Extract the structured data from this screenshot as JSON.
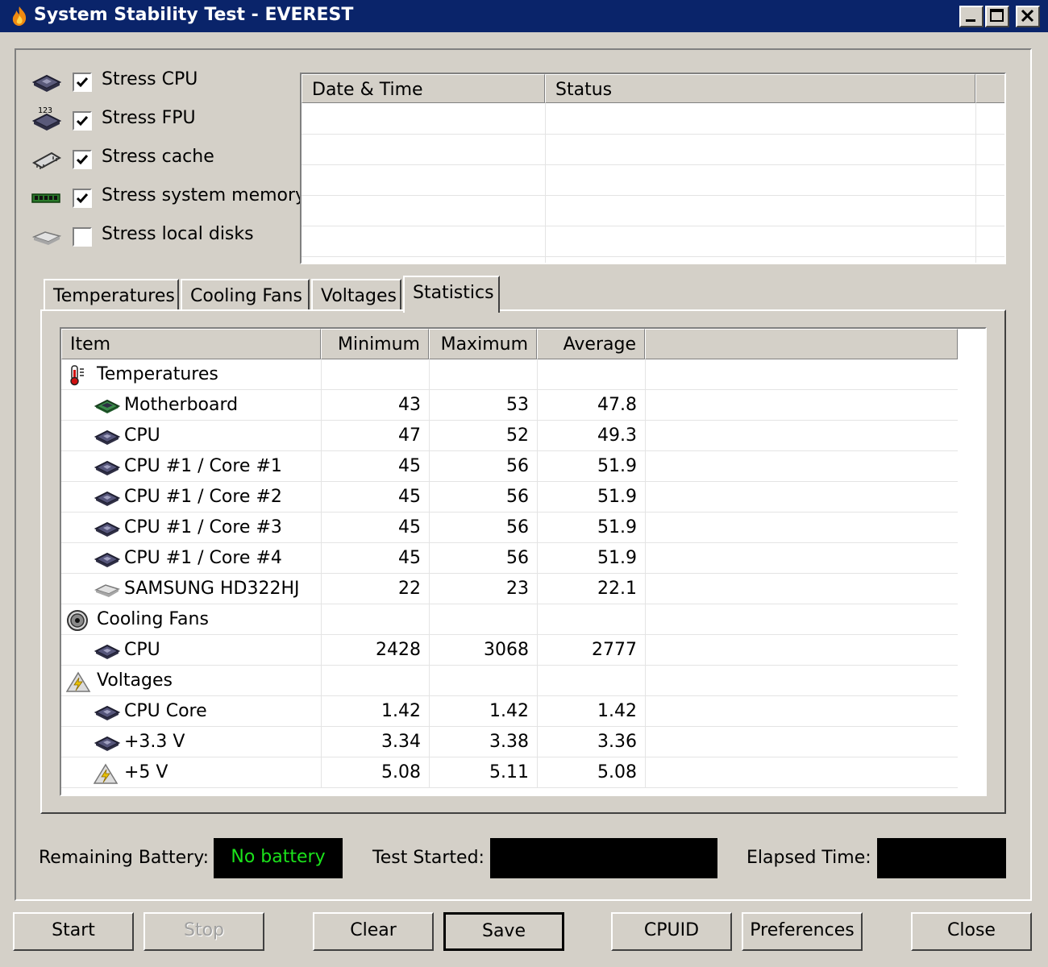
{
  "window": {
    "title": "System Stability Test - EVEREST"
  },
  "stress_options": [
    {
      "label": "Stress CPU",
      "checked": true,
      "icon": "cpu-chip-icon"
    },
    {
      "label": "Stress FPU",
      "checked": true,
      "icon": "fpu-chip-icon"
    },
    {
      "label": "Stress cache",
      "checked": true,
      "icon": "cache-chip-icon"
    },
    {
      "label": "Stress system memory",
      "checked": true,
      "icon": "memory-module-icon"
    },
    {
      "label": "Stress local disks",
      "checked": false,
      "icon": "hard-disk-icon"
    }
  ],
  "log": {
    "columns": [
      "Date & Time",
      "Status"
    ],
    "rows": []
  },
  "tabs": [
    {
      "label": "Temperatures",
      "active": false
    },
    {
      "label": "Cooling Fans",
      "active": false
    },
    {
      "label": "Voltages",
      "active": false
    },
    {
      "label": "Statistics",
      "active": true
    }
  ],
  "statistics": {
    "columns": [
      "Item",
      "Minimum",
      "Maximum",
      "Average"
    ],
    "rows": [
      {
        "type": "group",
        "name": "Temperatures",
        "icon": "thermometer-icon"
      },
      {
        "type": "item",
        "name": "Motherboard",
        "min": "43",
        "max": "53",
        "avg": "47.8",
        "icon": "motherboard-icon"
      },
      {
        "type": "item",
        "name": "CPU",
        "min": "47",
        "max": "52",
        "avg": "49.3",
        "icon": "cpu-chip-icon"
      },
      {
        "type": "item",
        "name": "CPU #1 / Core #1",
        "min": "45",
        "max": "56",
        "avg": "51.9",
        "icon": "cpu-chip-icon"
      },
      {
        "type": "item",
        "name": "CPU #1 / Core #2",
        "min": "45",
        "max": "56",
        "avg": "51.9",
        "icon": "cpu-chip-icon"
      },
      {
        "type": "item",
        "name": "CPU #1 / Core #3",
        "min": "45",
        "max": "56",
        "avg": "51.9",
        "icon": "cpu-chip-icon"
      },
      {
        "type": "item",
        "name": "CPU #1 / Core #4",
        "min": "45",
        "max": "56",
        "avg": "51.9",
        "icon": "cpu-chip-icon"
      },
      {
        "type": "item",
        "name": "SAMSUNG HD322HJ",
        "min": "22",
        "max": "23",
        "avg": "22.1",
        "icon": "hard-disk-icon"
      },
      {
        "type": "group",
        "name": "Cooling Fans",
        "icon": "fan-icon"
      },
      {
        "type": "item",
        "name": "CPU",
        "min": "2428",
        "max": "3068",
        "avg": "2777",
        "icon": "cpu-chip-icon"
      },
      {
        "type": "group",
        "name": "Voltages",
        "icon": "voltage-icon"
      },
      {
        "type": "item",
        "name": "CPU Core",
        "min": "1.42",
        "max": "1.42",
        "avg": "1.42",
        "icon": "cpu-chip-icon"
      },
      {
        "type": "item",
        "name": "+3.3 V",
        "min": "3.34",
        "max": "3.38",
        "avg": "3.36",
        "icon": "cpu-chip-icon"
      },
      {
        "type": "item",
        "name": "+5 V",
        "min": "5.08",
        "max": "5.11",
        "avg": "5.08",
        "icon": "voltage-icon"
      }
    ]
  },
  "status": {
    "battery_label": "Remaining Battery:",
    "battery_value": "No battery",
    "test_started_label": "Test Started:",
    "test_started_value": "",
    "elapsed_label": "Elapsed Time:",
    "elapsed_value": ""
  },
  "buttons": {
    "start": "Start",
    "stop": "Stop",
    "clear": "Clear",
    "save": "Save",
    "cpuid": "CPUID",
    "preferences": "Preferences",
    "close": "Close"
  },
  "colors": {
    "titlebar": "#0a246a",
    "face": "#d4d0c8",
    "lcd_text": "#1be21b",
    "lcd_background": "#000000"
  }
}
